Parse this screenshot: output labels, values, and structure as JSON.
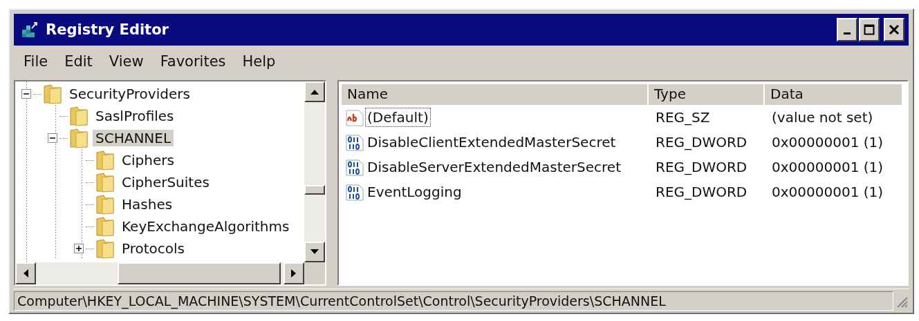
{
  "window": {
    "title": "Registry Editor"
  },
  "menu": [
    "File",
    "Edit",
    "View",
    "Favorites",
    "Help"
  ],
  "tree": {
    "items": [
      {
        "label": "SecurityProviders",
        "expanded": true,
        "selected": false,
        "children": [
          {
            "label": "SaslProfiles",
            "selected": false
          },
          {
            "label": "SCHANNEL",
            "expanded": true,
            "selected": true,
            "children": [
              {
                "label": "Ciphers",
                "selected": false
              },
              {
                "label": "CipherSuites",
                "selected": false
              },
              {
                "label": "Hashes",
                "selected": false
              },
              {
                "label": "KeyExchangeAlgorithms",
                "selected": false
              },
              {
                "label": "Protocols",
                "expanded": false,
                "selected": false
              }
            ]
          }
        ]
      }
    ]
  },
  "values": {
    "columns": [
      "Name",
      "Type",
      "Data"
    ],
    "rows": [
      {
        "kind": "string",
        "name": "(Default)",
        "type": "REG_SZ",
        "data": "(value not set)",
        "focused": true
      },
      {
        "kind": "dword",
        "name": "DisableClientExtendedMasterSecret",
        "type": "REG_DWORD",
        "data": "0x00000001 (1)",
        "focused": false
      },
      {
        "kind": "dword",
        "name": "DisableServerExtendedMasterSecret",
        "type": "REG_DWORD",
        "data": "0x00000001 (1)",
        "focused": false
      },
      {
        "kind": "dword",
        "name": "EventLogging",
        "type": "REG_DWORD",
        "data": "0x00000001 (1)",
        "focused": false
      }
    ]
  },
  "status_bar": "Computer\\HKEY_LOCAL_MACHINE\\SYSTEM\\CurrentControlSet\\Control\\SecurityProviders\\SCHANNEL"
}
